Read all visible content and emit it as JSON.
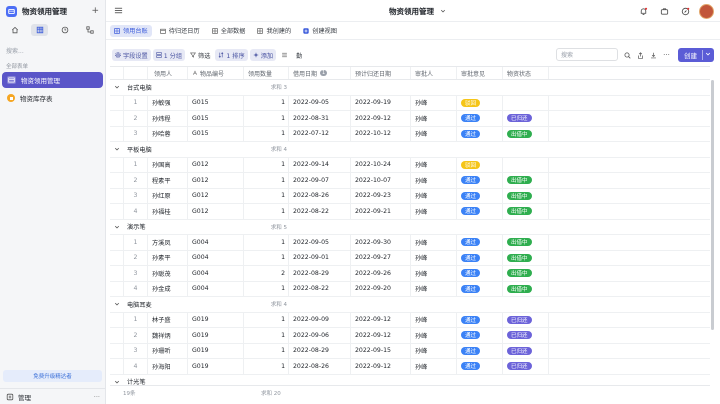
{
  "app": {
    "title": "物资领用管理",
    "add_label": "+"
  },
  "sidebar": {
    "search_placeholder": "搜索...",
    "section_label": "全部表单",
    "items": [
      {
        "label": "物资领用管理",
        "active": true,
        "icon_color": "#ffffff"
      },
      {
        "label": "物资库存表",
        "active": false,
        "icon_color": "#f5a623"
      }
    ],
    "upgrade_label": "免费升级精达者",
    "footer_label": "管理",
    "footer_more": "···"
  },
  "topbar": {
    "doc_title": "物资领用管理"
  },
  "views": [
    {
      "label": "领用台账",
      "active": true
    },
    {
      "label": "待归还日历",
      "active": false
    },
    {
      "label": "全部数据",
      "active": false
    },
    {
      "label": "我创建的",
      "active": false
    },
    {
      "label": "创建视图",
      "active": false
    }
  ],
  "toolbar": {
    "field_settings": "字段设置",
    "group": "1 分组",
    "filter": "筛选",
    "sort": "1 排序",
    "more": "添加",
    "row_height": "",
    "extra": "勤",
    "search_placeholder": "搜索",
    "create_label": "创建"
  },
  "columns": {
    "recipient": "领用人",
    "item_no": "物品编号",
    "qty": "领用数量",
    "borrow_date": "借用日期",
    "return_date": "预计归还日期",
    "approver": "审批人",
    "approval": "审批意见",
    "status": "物资状态",
    "borrow_badge": "1"
  },
  "colors": {
    "approved": "#3b82f6",
    "pending": "#f5c518",
    "returned": "#6c63d9",
    "outstanding": "#2fae4f"
  },
  "groups": [
    {
      "title": "台式电脑",
      "count": "求和 3",
      "rows": [
        {
          "idx": "1",
          "recipient": "孙敏强",
          "item_no": "G015",
          "qty": "1",
          "borrow": "2022-09-05",
          "ret": "2022-09-19",
          "approver": "孙峰",
          "approval": "驳回",
          "approval_color": "#f5c518",
          "status": "",
          "status_color": ""
        },
        {
          "idx": "2",
          "recipient": "孙炜程",
          "item_no": "G015",
          "qty": "1",
          "borrow": "2022-08-31",
          "ret": "2022-09-12",
          "approver": "孙峰",
          "approval": "通过",
          "approval_color": "#3b82f6",
          "status": "已归还",
          "status_color": "#6c63d9"
        },
        {
          "idx": "3",
          "recipient": "孙哈蓉",
          "item_no": "G015",
          "qty": "1",
          "borrow": "2022-07-12",
          "ret": "2022-10-12",
          "approver": "孙峰",
          "approval": "通过",
          "approval_color": "#3b82f6",
          "status": "出借中",
          "status_color": "#2fae4f"
        }
      ]
    },
    {
      "title": "平板电脑",
      "count": "求和 4",
      "rows": [
        {
          "idx": "1",
          "recipient": "孙国高",
          "item_no": "G012",
          "qty": "1",
          "borrow": "2022-09-14",
          "ret": "2022-10-24",
          "approver": "孙峰",
          "approval": "驳回",
          "approval_color": "#f5c518",
          "status": "",
          "status_color": ""
        },
        {
          "idx": "2",
          "recipient": "程素平",
          "item_no": "G012",
          "qty": "1",
          "borrow": "2022-09-07",
          "ret": "2022-10-07",
          "approver": "孙峰",
          "approval": "通过",
          "approval_color": "#3b82f6",
          "status": "出借中",
          "status_color": "#2fae4f"
        },
        {
          "idx": "3",
          "recipient": "孙红原",
          "item_no": "G012",
          "qty": "1",
          "borrow": "2022-08-26",
          "ret": "2022-09-23",
          "approver": "孙峰",
          "approval": "通过",
          "approval_color": "#3b82f6",
          "status": "出借中",
          "status_color": "#2fae4f"
        },
        {
          "idx": "4",
          "recipient": "孙福桂",
          "item_no": "G012",
          "qty": "1",
          "borrow": "2022-08-22",
          "ret": "2022-09-21",
          "approver": "孙峰",
          "approval": "通过",
          "approval_color": "#3b82f6",
          "status": "出借中",
          "status_color": "#2fae4f"
        }
      ]
    },
    {
      "title": "演示笔",
      "count": "求和 5",
      "rows": [
        {
          "idx": "1",
          "recipient": "方溪凤",
          "item_no": "G004",
          "qty": "1",
          "borrow": "2022-09-05",
          "ret": "2022-09-30",
          "approver": "孙峰",
          "approval": "通过",
          "approval_color": "#3b82f6",
          "status": "出借中",
          "status_color": "#2fae4f"
        },
        {
          "idx": "2",
          "recipient": "孙素平",
          "item_no": "G004",
          "qty": "1",
          "borrow": "2022-09-01",
          "ret": "2022-09-27",
          "approver": "孙峰",
          "approval": "通过",
          "approval_color": "#3b82f6",
          "status": "出借中",
          "status_color": "#2fae4f"
        },
        {
          "idx": "3",
          "recipient": "孙聪茂",
          "item_no": "G004",
          "qty": "2",
          "borrow": "2022-08-29",
          "ret": "2022-09-26",
          "approver": "孙峰",
          "approval": "通过",
          "approval_color": "#3b82f6",
          "status": "出借中",
          "status_color": "#2fae4f"
        },
        {
          "idx": "4",
          "recipient": "孙金成",
          "item_no": "G004",
          "qty": "1",
          "borrow": "2022-08-22",
          "ret": "2022-09-20",
          "approver": "孙峰",
          "approval": "通过",
          "approval_color": "#3b82f6",
          "status": "出借中",
          "status_color": "#2fae4f"
        }
      ]
    },
    {
      "title": "电脑耳麦",
      "count": "求和 4",
      "rows": [
        {
          "idx": "1",
          "recipient": "林子盛",
          "item_no": "G019",
          "qty": "1",
          "borrow": "2022-09-09",
          "ret": "2022-09-12",
          "approver": "孙峰",
          "approval": "通过",
          "approval_color": "#3b82f6",
          "status": "已归还",
          "status_color": "#6c63d9"
        },
        {
          "idx": "2",
          "recipient": "魏祥炳",
          "item_no": "G019",
          "qty": "1",
          "borrow": "2022-09-06",
          "ret": "2022-09-12",
          "approver": "孙峰",
          "approval": "通过",
          "approval_color": "#3b82f6",
          "status": "已归还",
          "status_color": "#6c63d9"
        },
        {
          "idx": "3",
          "recipient": "孙珊听",
          "item_no": "G019",
          "qty": "1",
          "borrow": "2022-08-29",
          "ret": "2022-09-15",
          "approver": "孙峰",
          "approval": "通过",
          "approval_color": "#3b82f6",
          "status": "已归还",
          "status_color": "#6c63d9"
        },
        {
          "idx": "4",
          "recipient": "孙海阳",
          "item_no": "G019",
          "qty": "1",
          "borrow": "2022-08-26",
          "ret": "2022-09-12",
          "approver": "孙峰",
          "approval": "通过",
          "approval_color": "#3b82f6",
          "status": "已归还",
          "status_color": "#6c63d9"
        }
      ]
    }
  ],
  "next_group_title": "计光笔",
  "footer": {
    "count": "19条",
    "sum": "求和 20"
  }
}
